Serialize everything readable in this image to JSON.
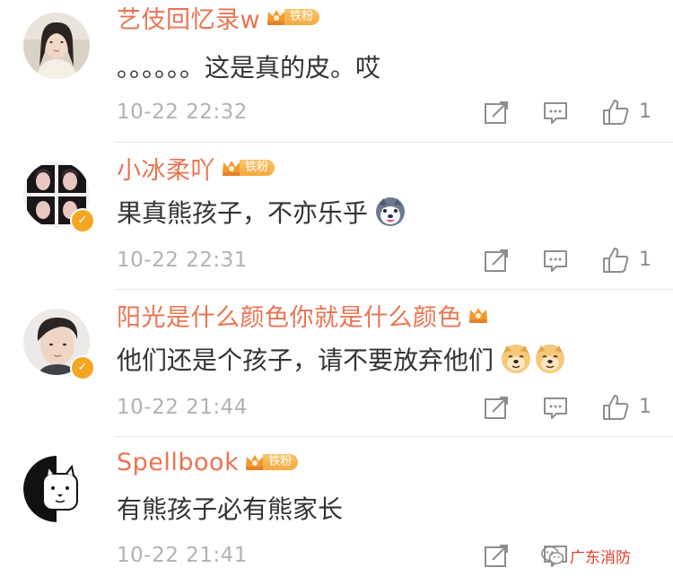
{
  "comments": [
    {
      "username": "艺伎回忆录w",
      "badge": "铁粉",
      "content": "。。。。。。这是真的皮。哎",
      "time": "10-22 22:32",
      "likes": "1",
      "verified": false,
      "emojis": []
    },
    {
      "username": "小冰柔吖",
      "badge": "铁粉",
      "content": "果真熊孩子，不亦乐乎",
      "time": "10-22 22:31",
      "likes": "1",
      "verified": true,
      "emojis": [
        "husky-emoji"
      ]
    },
    {
      "username": "阳光是什么颜色你就是什么颜色",
      "badge": "",
      "content": "他们还是个孩子，请不要放弃他们",
      "time": "10-22 21:44",
      "likes": "1",
      "verified": true,
      "emojis": [
        "doge-emoji",
        "doge-emoji"
      ]
    },
    {
      "username": "Spellbook",
      "badge": "铁粉",
      "content": "有熊孩子必有熊家长",
      "time": "10-22 21:41",
      "likes": "",
      "verified": false,
      "emojis": []
    }
  ],
  "watermark": {
    "text": "广东消防"
  },
  "colors": {
    "username": "#eb7350",
    "content": "#333333",
    "time": "#b2b2b2",
    "badge": "#f4a93e",
    "watermark": "#e23b2a"
  }
}
